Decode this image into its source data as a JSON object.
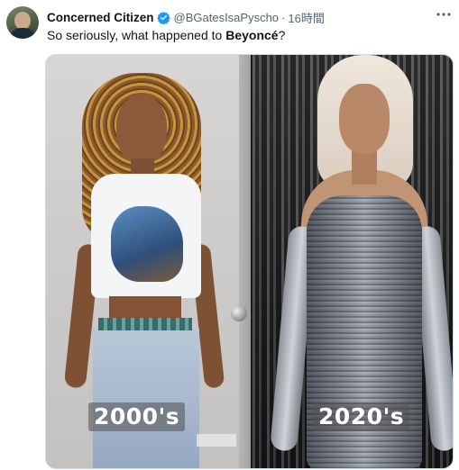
{
  "tweet": {
    "display_name": "Concerned Citizen",
    "handle": "@BGatesIsaPyscho",
    "separator": "·",
    "time": "16時間",
    "text_before": "So seriously, what happened to ",
    "text_bold": "Beyoncé",
    "text_after": "?",
    "more_icon": "more-horizontal-icon",
    "verified_icon": "verified-badge-icon"
  },
  "media": {
    "left_caption": "2000's",
    "right_caption": "2020's"
  },
  "colors": {
    "verified": "#1d9bf0",
    "secondary_text": "#536471",
    "primary_text": "#0f1419"
  }
}
